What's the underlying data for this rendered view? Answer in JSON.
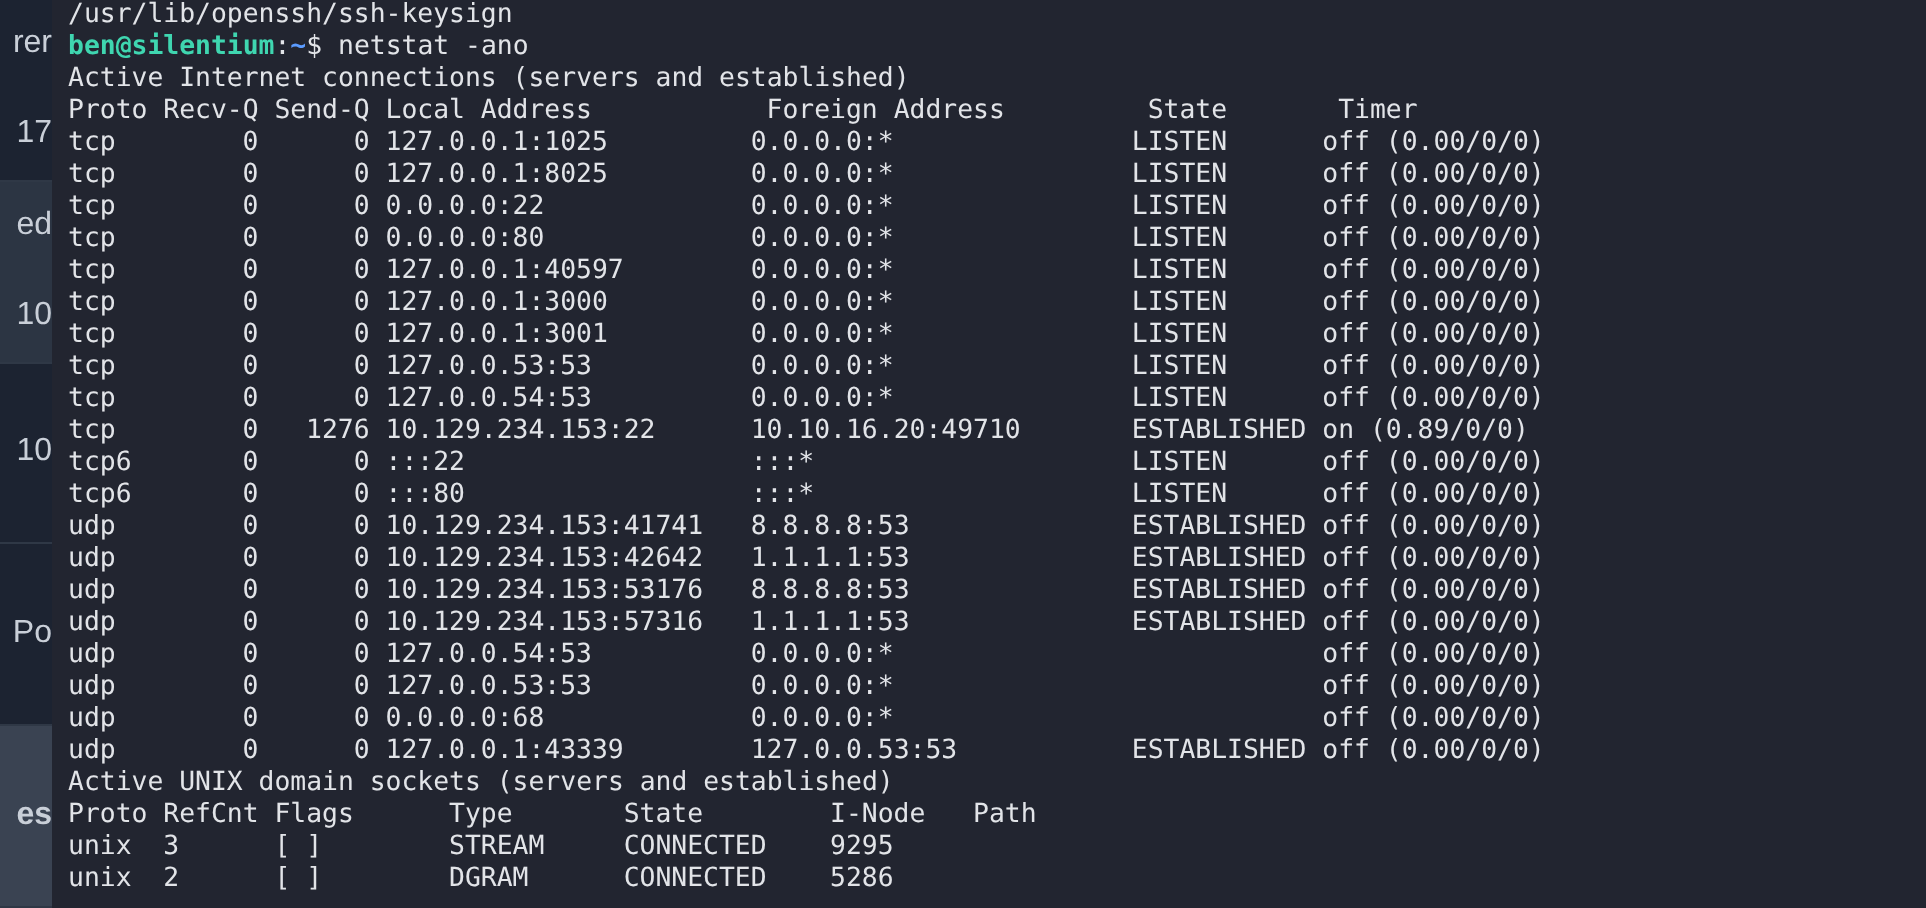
{
  "background_page": {
    "segments": [
      {
        "kind": "dark",
        "texts": [
          "rer",
          "17"
        ]
      },
      {
        "kind": "mid",
        "texts": [
          "ed",
          "10"
        ]
      },
      {
        "kind": "dark",
        "texts": [
          "10"
        ]
      },
      {
        "kind": "dark",
        "texts": [
          "Po"
        ]
      },
      {
        "kind": "light",
        "texts": [
          "es"
        ]
      }
    ]
  },
  "terminal": {
    "lines_before": [
      "/usr/lib/openssh/ssh-keysign"
    ],
    "prompt": {
      "user_host": "ben@silentium",
      "separator": ":",
      "path": "~",
      "symbol": "$",
      "command": "netstat -ano"
    },
    "inet_heading": "Active Internet connections (servers and established)",
    "inet_columns": [
      "Proto",
      "Recv-Q",
      "Send-Q",
      "Local Address",
      "Foreign Address",
      "State",
      "Timer"
    ],
    "inet_rows": [
      {
        "proto": "tcp",
        "recv_q": "0",
        "send_q": "0",
        "local": "127.0.0.1:1025",
        "foreign": "0.0.0.0:*",
        "state": "LISTEN",
        "timer": "off (0.00/0/0)"
      },
      {
        "proto": "tcp",
        "recv_q": "0",
        "send_q": "0",
        "local": "127.0.0.1:8025",
        "foreign": "0.0.0.0:*",
        "state": "LISTEN",
        "timer": "off (0.00/0/0)"
      },
      {
        "proto": "tcp",
        "recv_q": "0",
        "send_q": "0",
        "local": "0.0.0.0:22",
        "foreign": "0.0.0.0:*",
        "state": "LISTEN",
        "timer": "off (0.00/0/0)"
      },
      {
        "proto": "tcp",
        "recv_q": "0",
        "send_q": "0",
        "local": "0.0.0.0:80",
        "foreign": "0.0.0.0:*",
        "state": "LISTEN",
        "timer": "off (0.00/0/0)"
      },
      {
        "proto": "tcp",
        "recv_q": "0",
        "send_q": "0",
        "local": "127.0.0.1:40597",
        "foreign": "0.0.0.0:*",
        "state": "LISTEN",
        "timer": "off (0.00/0/0)"
      },
      {
        "proto": "tcp",
        "recv_q": "0",
        "send_q": "0",
        "local": "127.0.0.1:3000",
        "foreign": "0.0.0.0:*",
        "state": "LISTEN",
        "timer": "off (0.00/0/0)"
      },
      {
        "proto": "tcp",
        "recv_q": "0",
        "send_q": "0",
        "local": "127.0.0.1:3001",
        "foreign": "0.0.0.0:*",
        "state": "LISTEN",
        "timer": "off (0.00/0/0)"
      },
      {
        "proto": "tcp",
        "recv_q": "0",
        "send_q": "0",
        "local": "127.0.0.53:53",
        "foreign": "0.0.0.0:*",
        "state": "LISTEN",
        "timer": "off (0.00/0/0)"
      },
      {
        "proto": "tcp",
        "recv_q": "0",
        "send_q": "0",
        "local": "127.0.0.54:53",
        "foreign": "0.0.0.0:*",
        "state": "LISTEN",
        "timer": "off (0.00/0/0)"
      },
      {
        "proto": "tcp",
        "recv_q": "0",
        "send_q": "1276",
        "local": "10.129.234.153:22",
        "foreign": "10.10.16.20:49710",
        "state": "ESTABLISHED",
        "timer": "on (0.89/0/0)"
      },
      {
        "proto": "tcp6",
        "recv_q": "0",
        "send_q": "0",
        "local": ":::22",
        "foreign": ":::*",
        "state": "LISTEN",
        "timer": "off (0.00/0/0)"
      },
      {
        "proto": "tcp6",
        "recv_q": "0",
        "send_q": "0",
        "local": ":::80",
        "foreign": ":::*",
        "state": "LISTEN",
        "timer": "off (0.00/0/0)"
      },
      {
        "proto": "udp",
        "recv_q": "0",
        "send_q": "0",
        "local": "10.129.234.153:41741",
        "foreign": "8.8.8.8:53",
        "state": "ESTABLISHED",
        "timer": "off (0.00/0/0)"
      },
      {
        "proto": "udp",
        "recv_q": "0",
        "send_q": "0",
        "local": "10.129.234.153:42642",
        "foreign": "1.1.1.1:53",
        "state": "ESTABLISHED",
        "timer": "off (0.00/0/0)"
      },
      {
        "proto": "udp",
        "recv_q": "0",
        "send_q": "0",
        "local": "10.129.234.153:53176",
        "foreign": "8.8.8.8:53",
        "state": "ESTABLISHED",
        "timer": "off (0.00/0/0)"
      },
      {
        "proto": "udp",
        "recv_q": "0",
        "send_q": "0",
        "local": "10.129.234.153:57316",
        "foreign": "1.1.1.1:53",
        "state": "ESTABLISHED",
        "timer": "off (0.00/0/0)"
      },
      {
        "proto": "udp",
        "recv_q": "0",
        "send_q": "0",
        "local": "127.0.0.54:53",
        "foreign": "0.0.0.0:*",
        "timer": "off (0.00/0/0)"
      },
      {
        "proto": "udp",
        "recv_q": "0",
        "send_q": "0",
        "local": "127.0.0.53:53",
        "foreign": "0.0.0.0:*",
        "timer": "off (0.00/0/0)"
      },
      {
        "proto": "udp",
        "recv_q": "0",
        "send_q": "0",
        "local": "0.0.0.0:68",
        "foreign": "0.0.0.0:*",
        "timer": "off (0.00/0/0)"
      },
      {
        "proto": "udp",
        "recv_q": "0",
        "send_q": "0",
        "local": "127.0.0.1:43339",
        "foreign": "127.0.0.53:53",
        "state": "ESTABLISHED",
        "timer": "off (0.00/0/0)"
      }
    ],
    "unix_heading": "Active UNIX domain sockets (servers and established)",
    "unix_columns": [
      "Proto",
      "RefCnt",
      "Flags",
      "Type",
      "State",
      "I-Node",
      "Path"
    ],
    "unix_rows": [
      {
        "proto": "unix",
        "refcnt": "3",
        "flags": "[ ]",
        "type": "STREAM",
        "state": "CONNECTED",
        "inode": "9295"
      },
      {
        "proto": "unix",
        "refcnt": "2",
        "flags": "[ ]",
        "type": "DGRAM",
        "state": "CONNECTED",
        "inode": "5286"
      }
    ]
  }
}
